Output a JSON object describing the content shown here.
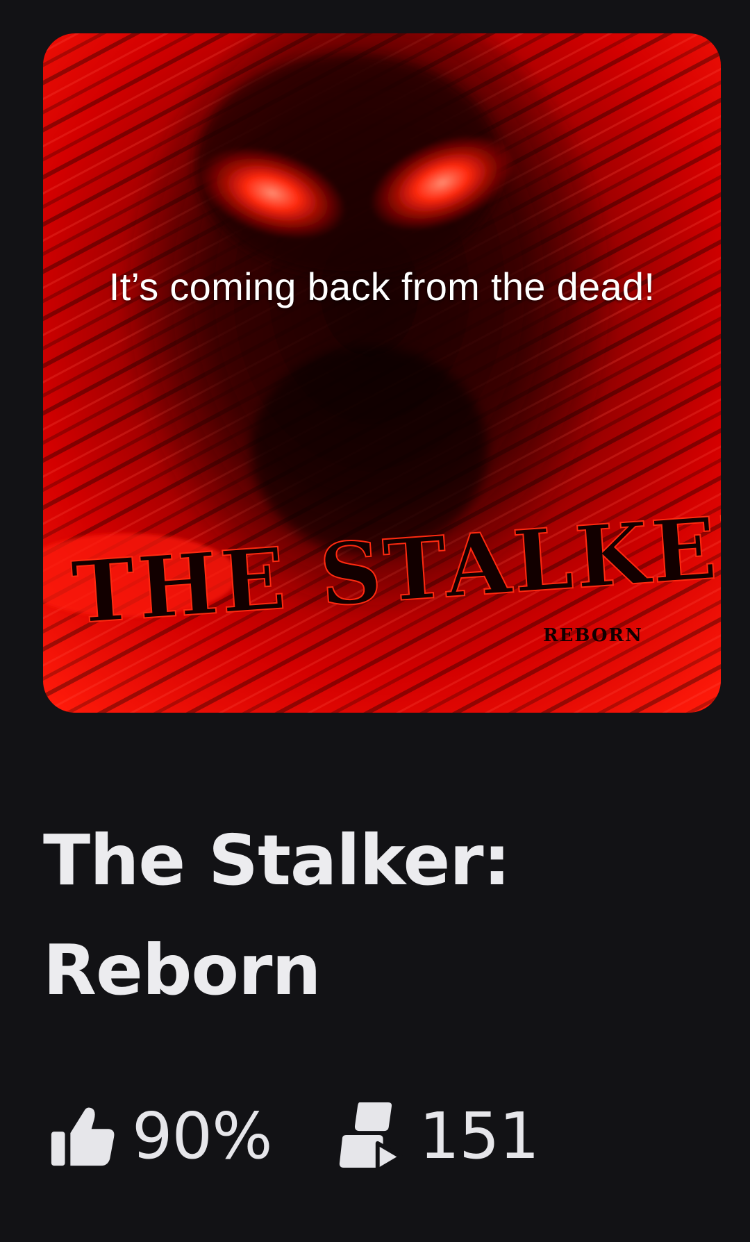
{
  "thumbnail": {
    "overlay_caption": "It’s coming back from the dead!",
    "logo_text": "THE STALKER",
    "logo_subtext": "REBORN"
  },
  "game": {
    "title": "The Stalker: Reborn"
  },
  "stats": {
    "rating": "90%",
    "rating_icon": "thumbs-up-icon",
    "players": "151",
    "players_icon": "players-icon"
  },
  "colors": {
    "background": "#121215",
    "thumbnail_red": "#e00000",
    "text": "#ececef"
  }
}
